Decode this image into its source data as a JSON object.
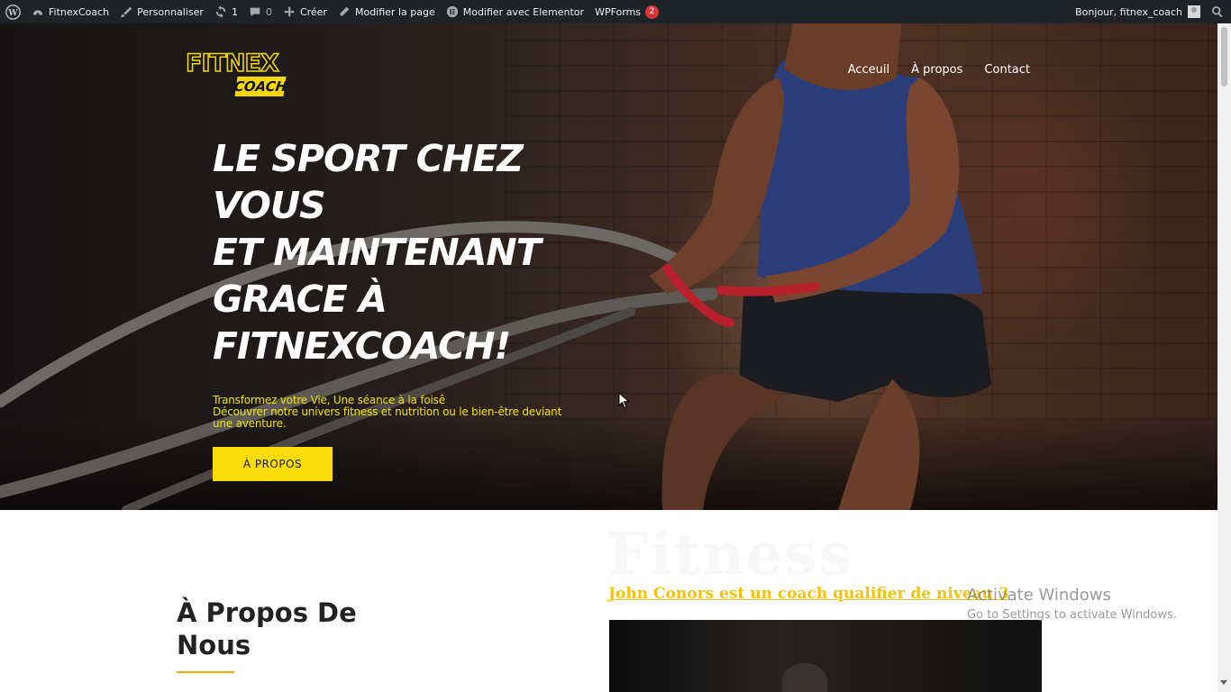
{
  "admin_bar": {
    "site_name": "FitnexCoach",
    "customize": "Personnaliser",
    "updates_count": "1",
    "comments_count": "0",
    "new": "Créer",
    "edit_page": "Modifier la page",
    "edit_elementor": "Modifier avec Elementor",
    "wpforms": "WPForms",
    "wpforms_badge": "2",
    "greeting": "Bonjour, fitnex_coach"
  },
  "logo": {
    "top": "FITNEX",
    "sub": "COACH"
  },
  "nav": {
    "items": [
      "Acceuil",
      "À propos",
      "Contact"
    ]
  },
  "hero": {
    "headline_lines": [
      "LE SPORT CHEZ",
      "VOUS",
      "ET MAINTENANT",
      "GRACE À",
      "FITNEXCOACH!"
    ],
    "tagline_lines": [
      "Transformez votre Vie, Une séance à la foisê",
      "Découvrer notre univers fitness et nutrition ou le bien-être deviant",
      "une aventure."
    ],
    "cta_label": "À PROPOS"
  },
  "about": {
    "title_lines": [
      "À Propos De",
      "Nous"
    ],
    "ghost_text": "Fitness",
    "coach_link": "John Conors est un coach qualifier de niveau 3"
  },
  "watermark": {
    "line1": "Activate Windows",
    "line2": "Go to Settings to activate Windows."
  },
  "colors": {
    "accent_yellow": "#f7dc0a",
    "admin_bar": "#1d2327",
    "badge_red": "#d63638",
    "link_gold": "#f4c20d"
  }
}
